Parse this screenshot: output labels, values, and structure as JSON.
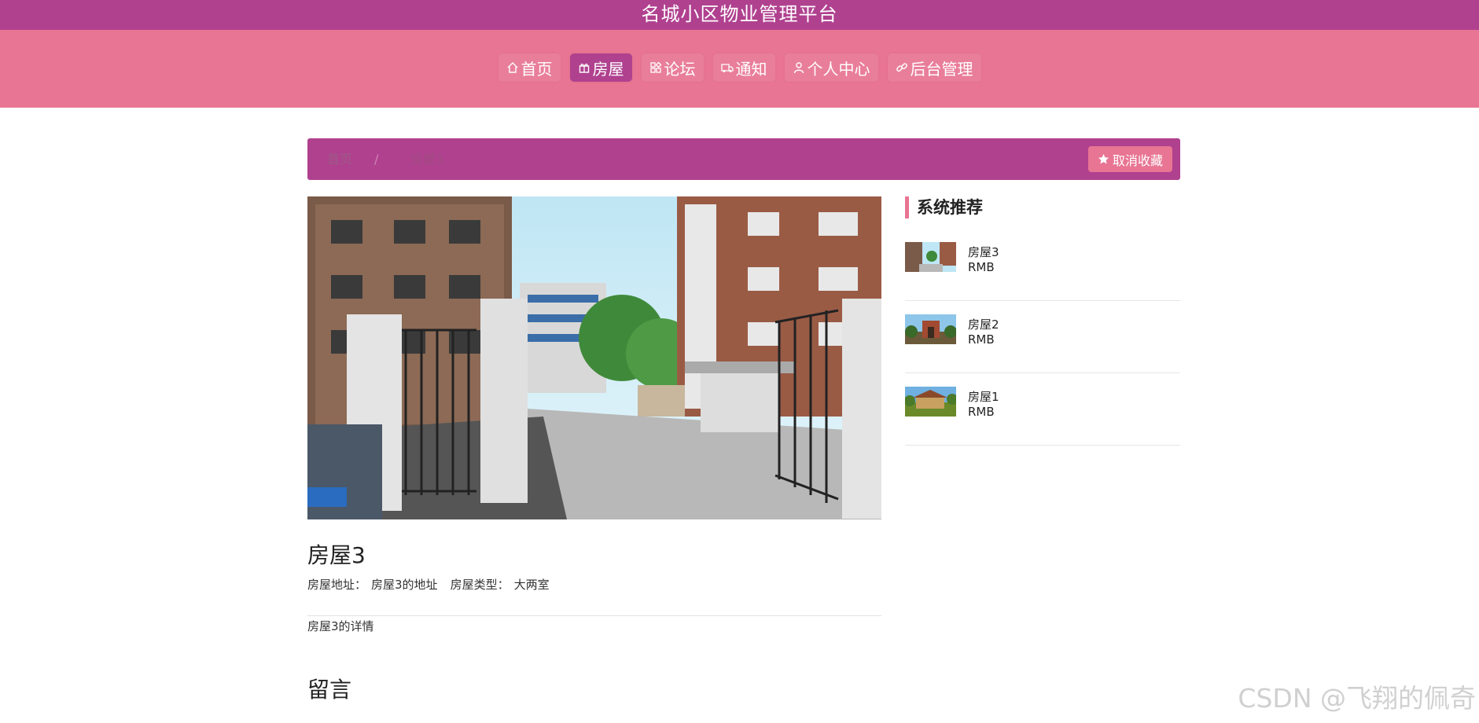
{
  "header": {
    "site_title": "名城小区物业管理平台"
  },
  "nav": {
    "items": [
      {
        "label": "首页",
        "icon": "home-icon"
      },
      {
        "label": "房屋",
        "icon": "gift-icon",
        "active": true
      },
      {
        "label": "论坛",
        "icon": "grid-icon"
      },
      {
        "label": "通知",
        "icon": "truck-icon"
      },
      {
        "label": "个人中心",
        "icon": "user-icon"
      },
      {
        "label": "后台管理",
        "icon": "link-icon"
      }
    ]
  },
  "breadcrumb": {
    "home": "首页",
    "separator": "/",
    "current": "房屋3"
  },
  "favorite_button": {
    "label": "取消收藏",
    "icon": "star-icon"
  },
  "house": {
    "title": "房屋3",
    "address_label": "房屋地址：",
    "address_value": "房屋3的地址",
    "type_label": "房屋类型：",
    "type_value": "大两室",
    "detail": "房屋3的详情"
  },
  "comments": {
    "heading": "留言"
  },
  "recommend": {
    "heading": "系统推荐",
    "items": [
      {
        "name": "房屋3",
        "price": "RMB"
      },
      {
        "name": "房屋2",
        "price": "RMB"
      },
      {
        "name": "房屋1",
        "price": "RMB"
      }
    ]
  },
  "watermark": "CSDN @飞翔的佩奇",
  "colors": {
    "primary": "#b0418f",
    "accent": "#e87593"
  }
}
